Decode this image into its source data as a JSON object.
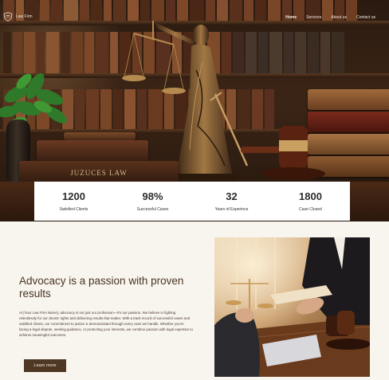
{
  "nav": {
    "logo_text": "Law Firm",
    "links": [
      {
        "label": "Home"
      },
      {
        "label": "Services"
      },
      {
        "label": "About us"
      },
      {
        "label": "Contact us"
      }
    ]
  },
  "hero": {
    "book_spine_text": "JUZUCES LAW"
  },
  "stats": [
    {
      "value": "1200",
      "label": "Satisfied Clients"
    },
    {
      "value": "98%",
      "label": "Successful Cases"
    },
    {
      "value": "32",
      "label": "Years of Experince"
    },
    {
      "value": "1800",
      "label": "Case Closed"
    }
  ],
  "about": {
    "title": "Advocacy is a passion with proven results",
    "body": "At [Your Law Firm Name], advocacy is not just our profession—it's our passion. We believe in fighting relentlessly for our clients' rights and delivering results that matter. With a track record of successful cases and satisfied clients, our commitment to justice is demonstrated through every case we handle. Whether you're facing a legal dispute, seeking guidance, or protecting your interests, we combine passion with legal expertise to achieve meaningful outcomes.",
    "button_label": "Learn more"
  },
  "colors": {
    "accent": "#4e3824",
    "page_bg": "#f8f5ef",
    "stats_bg": "#ffffff",
    "heading": "#4a3420"
  },
  "icons": {
    "logo": "shield-scales-icon"
  }
}
